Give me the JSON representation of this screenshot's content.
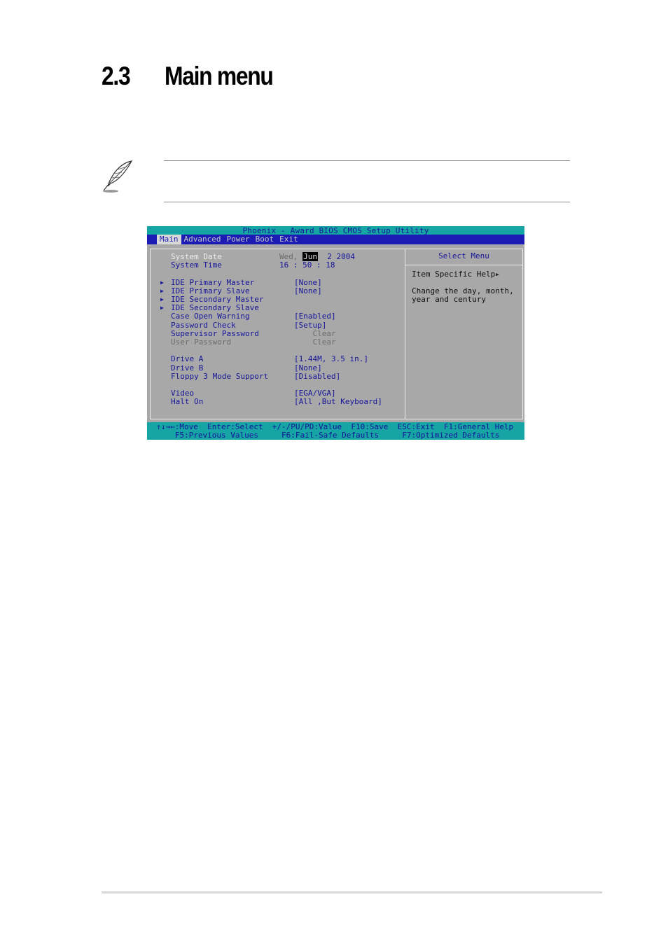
{
  "section": {
    "number": "2.3",
    "title": "Main menu"
  },
  "note": {
    "icon": "feather-pen-icon"
  },
  "bios": {
    "title": "Phoenix - Award BIOS CMOS Setup Utility",
    "menu": [
      "Main",
      "Advanced",
      "Power",
      "Boot",
      "Exit"
    ],
    "active_menu": "Main",
    "rows": [
      {
        "label": "System Date",
        "value_pre": "Wed, ",
        "value_sel": "Jun",
        "value_post": "  2 2004",
        "highlight": true
      },
      {
        "label": "System Time",
        "value": "16 : 50 : 18"
      },
      {
        "spacer": true
      },
      {
        "label": "IDE Primary Master",
        "value": "[None]",
        "submenu": true
      },
      {
        "label": "IDE Primary Slave",
        "value": "[None]",
        "submenu": true
      },
      {
        "label": "IDE Secondary Master",
        "value": "",
        "submenu": true
      },
      {
        "label": "IDE Secondary Slave",
        "value": "",
        "submenu": true
      },
      {
        "label": "Case Open Warning",
        "value": "[Enabled]"
      },
      {
        "label": "Password Check",
        "value": "[Setup]"
      },
      {
        "label": "Supervisor Password",
        "value": "    Clear",
        "value_dim": true
      },
      {
        "label": "User Password",
        "value": "    Clear",
        "disabled": true
      },
      {
        "spacer": true
      },
      {
        "label": "Drive A",
        "value": "[1.44M, 3.5 in.]"
      },
      {
        "label": "Drive B",
        "value": "[None]"
      },
      {
        "label": "Floppy 3 Mode Support",
        "value": "[Disabled]"
      },
      {
        "spacer": true
      },
      {
        "label": "Video",
        "value": "[EGA/VGA]"
      },
      {
        "label": "Halt On",
        "value": "[All ,But Keyboard]"
      }
    ],
    "help": {
      "title": "Select Menu",
      "heading": "Item Specific Help▸",
      "line1": "Change the day, month,",
      "line2": "year and century"
    },
    "footer": {
      "line1": "  ↑↓→←:Move  Enter:Select  +/-/PU/PD:Value  F10:Save  ESC:Exit  F1:General Help",
      "line2": "      F5:Previous Values     F6:Fail-Safe Defaults     F7:Optimized Defaults"
    },
    "colors": {
      "cyan": "#16a4a4",
      "blue": "#1c1cb4",
      "grey": "#a8a8a8"
    }
  }
}
